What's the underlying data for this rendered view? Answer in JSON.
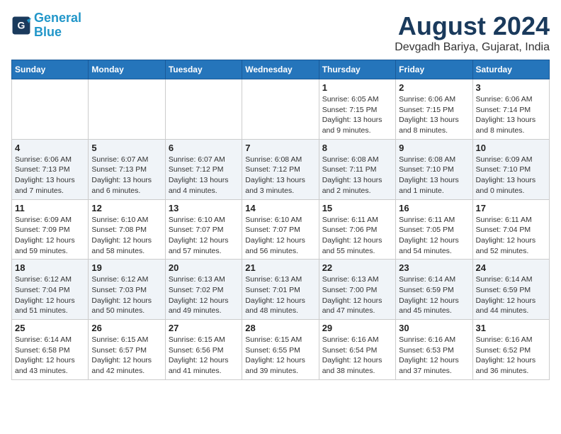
{
  "logo": {
    "line1": "General",
    "line2": "Blue"
  },
  "title": "August 2024",
  "subtitle": "Devgadh Bariya, Gujarat, India",
  "days_of_week": [
    "Sunday",
    "Monday",
    "Tuesday",
    "Wednesday",
    "Thursday",
    "Friday",
    "Saturday"
  ],
  "weeks": [
    [
      {
        "day": "",
        "info": ""
      },
      {
        "day": "",
        "info": ""
      },
      {
        "day": "",
        "info": ""
      },
      {
        "day": "",
        "info": ""
      },
      {
        "day": "1",
        "info": "Sunrise: 6:05 AM\nSunset: 7:15 PM\nDaylight: 13 hours\nand 9 minutes."
      },
      {
        "day": "2",
        "info": "Sunrise: 6:06 AM\nSunset: 7:15 PM\nDaylight: 13 hours\nand 8 minutes."
      },
      {
        "day": "3",
        "info": "Sunrise: 6:06 AM\nSunset: 7:14 PM\nDaylight: 13 hours\nand 8 minutes."
      }
    ],
    [
      {
        "day": "4",
        "info": "Sunrise: 6:06 AM\nSunset: 7:13 PM\nDaylight: 13 hours\nand 7 minutes."
      },
      {
        "day": "5",
        "info": "Sunrise: 6:07 AM\nSunset: 7:13 PM\nDaylight: 13 hours\nand 6 minutes."
      },
      {
        "day": "6",
        "info": "Sunrise: 6:07 AM\nSunset: 7:12 PM\nDaylight: 13 hours\nand 4 minutes."
      },
      {
        "day": "7",
        "info": "Sunrise: 6:08 AM\nSunset: 7:12 PM\nDaylight: 13 hours\nand 3 minutes."
      },
      {
        "day": "8",
        "info": "Sunrise: 6:08 AM\nSunset: 7:11 PM\nDaylight: 13 hours\nand 2 minutes."
      },
      {
        "day": "9",
        "info": "Sunrise: 6:08 AM\nSunset: 7:10 PM\nDaylight: 13 hours\nand 1 minute."
      },
      {
        "day": "10",
        "info": "Sunrise: 6:09 AM\nSunset: 7:10 PM\nDaylight: 13 hours\nand 0 minutes."
      }
    ],
    [
      {
        "day": "11",
        "info": "Sunrise: 6:09 AM\nSunset: 7:09 PM\nDaylight: 12 hours\nand 59 minutes."
      },
      {
        "day": "12",
        "info": "Sunrise: 6:10 AM\nSunset: 7:08 PM\nDaylight: 12 hours\nand 58 minutes."
      },
      {
        "day": "13",
        "info": "Sunrise: 6:10 AM\nSunset: 7:07 PM\nDaylight: 12 hours\nand 57 minutes."
      },
      {
        "day": "14",
        "info": "Sunrise: 6:10 AM\nSunset: 7:07 PM\nDaylight: 12 hours\nand 56 minutes."
      },
      {
        "day": "15",
        "info": "Sunrise: 6:11 AM\nSunset: 7:06 PM\nDaylight: 12 hours\nand 55 minutes."
      },
      {
        "day": "16",
        "info": "Sunrise: 6:11 AM\nSunset: 7:05 PM\nDaylight: 12 hours\nand 54 minutes."
      },
      {
        "day": "17",
        "info": "Sunrise: 6:11 AM\nSunset: 7:04 PM\nDaylight: 12 hours\nand 52 minutes."
      }
    ],
    [
      {
        "day": "18",
        "info": "Sunrise: 6:12 AM\nSunset: 7:04 PM\nDaylight: 12 hours\nand 51 minutes."
      },
      {
        "day": "19",
        "info": "Sunrise: 6:12 AM\nSunset: 7:03 PM\nDaylight: 12 hours\nand 50 minutes."
      },
      {
        "day": "20",
        "info": "Sunrise: 6:13 AM\nSunset: 7:02 PM\nDaylight: 12 hours\nand 49 minutes."
      },
      {
        "day": "21",
        "info": "Sunrise: 6:13 AM\nSunset: 7:01 PM\nDaylight: 12 hours\nand 48 minutes."
      },
      {
        "day": "22",
        "info": "Sunrise: 6:13 AM\nSunset: 7:00 PM\nDaylight: 12 hours\nand 47 minutes."
      },
      {
        "day": "23",
        "info": "Sunrise: 6:14 AM\nSunset: 6:59 PM\nDaylight: 12 hours\nand 45 minutes."
      },
      {
        "day": "24",
        "info": "Sunrise: 6:14 AM\nSunset: 6:59 PM\nDaylight: 12 hours\nand 44 minutes."
      }
    ],
    [
      {
        "day": "25",
        "info": "Sunrise: 6:14 AM\nSunset: 6:58 PM\nDaylight: 12 hours\nand 43 minutes."
      },
      {
        "day": "26",
        "info": "Sunrise: 6:15 AM\nSunset: 6:57 PM\nDaylight: 12 hours\nand 42 minutes."
      },
      {
        "day": "27",
        "info": "Sunrise: 6:15 AM\nSunset: 6:56 PM\nDaylight: 12 hours\nand 41 minutes."
      },
      {
        "day": "28",
        "info": "Sunrise: 6:15 AM\nSunset: 6:55 PM\nDaylight: 12 hours\nand 39 minutes."
      },
      {
        "day": "29",
        "info": "Sunrise: 6:16 AM\nSunset: 6:54 PM\nDaylight: 12 hours\nand 38 minutes."
      },
      {
        "day": "30",
        "info": "Sunrise: 6:16 AM\nSunset: 6:53 PM\nDaylight: 12 hours\nand 37 minutes."
      },
      {
        "day": "31",
        "info": "Sunrise: 6:16 AM\nSunset: 6:52 PM\nDaylight: 12 hours\nand 36 minutes."
      }
    ]
  ]
}
